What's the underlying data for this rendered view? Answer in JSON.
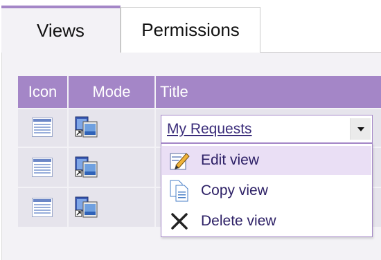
{
  "tabs": [
    {
      "label": "Views",
      "active": true
    },
    {
      "label": "Permissions",
      "active": false
    }
  ],
  "table": {
    "headers": {
      "icon": "Icon",
      "mode": "Mode",
      "title": "Title"
    },
    "rows": [
      {
        "icon": "list-view-icon",
        "mode": "window-mode-icon",
        "title": "My Requests"
      },
      {
        "icon": "list-view-icon",
        "mode": "window-mode-icon",
        "title": ""
      },
      {
        "icon": "list-view-icon",
        "mode": "window-mode-icon",
        "title": ""
      }
    ]
  },
  "menu": {
    "items": [
      {
        "label": "Edit view",
        "icon": "edit-icon",
        "highlighted": true
      },
      {
        "label": "Copy view",
        "icon": "copy-icon",
        "highlighted": false
      },
      {
        "label": "Delete view",
        "icon": "delete-icon",
        "highlighted": false
      }
    ]
  },
  "colors": {
    "accent": "#a486c7",
    "header_text": "#ffffff",
    "row_bg": "#e6e4ec",
    "link": "#3a2c7a",
    "menu_highlight": "#eadff5"
  }
}
